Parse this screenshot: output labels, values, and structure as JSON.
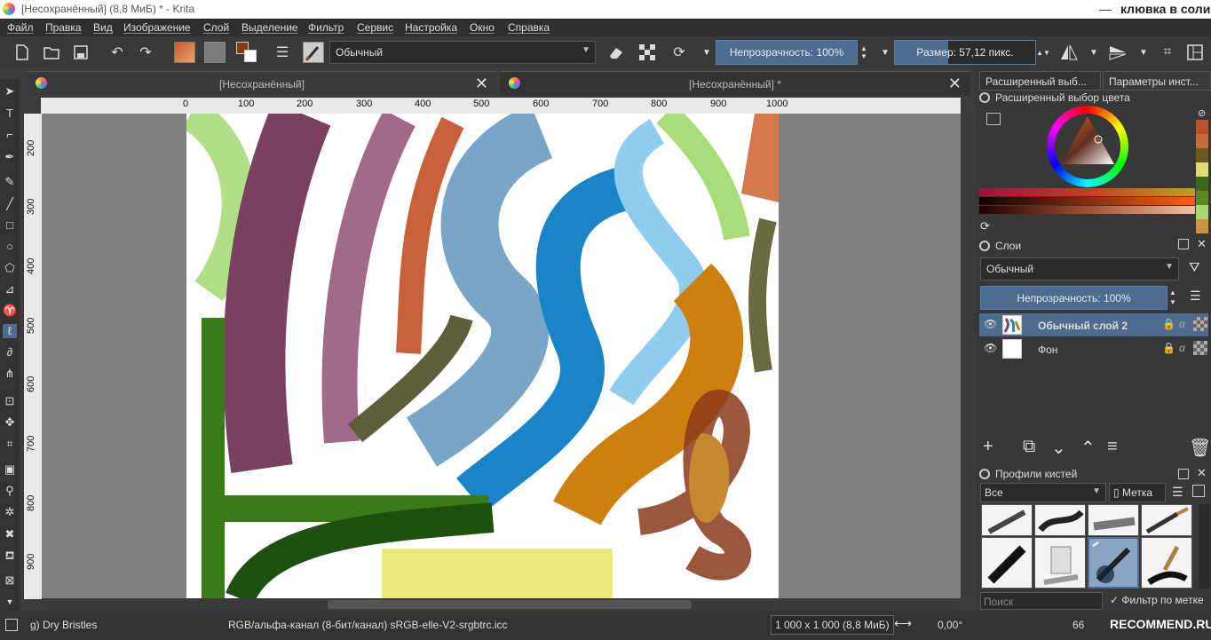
{
  "window": {
    "title": "[Несохранённый]  (8,8 МиБ)  * - Krita",
    "minimize_icon": "minimize-icon",
    "watermark": "клювка в соли"
  },
  "menu": [
    "Файл",
    "Правка",
    "Вид",
    "Изображение",
    "Слой",
    "Выделение",
    "Фильтр",
    "Сервис",
    "Настройка",
    "Окно",
    "Справка"
  ],
  "toolbar": {
    "blend_mode": "Обычный",
    "opacity_label": "Непрозрачность: 100%",
    "size_label": "Размер: 57,12 пикс."
  },
  "tabs": [
    {
      "label": "[Несохранённый]"
    },
    {
      "label": "[Несохранённый]  *"
    }
  ],
  "ruler": {
    "h": [
      "0",
      "100",
      "200",
      "300",
      "400",
      "500",
      "600",
      "700",
      "800",
      "900",
      "1000"
    ],
    "v": [
      "200",
      "300",
      "400",
      "500",
      "600",
      "700",
      "800",
      "900"
    ]
  },
  "right_panel": {
    "tab1": "Расширенный выб...",
    "tab2": "Параметры инст...",
    "color_title": "Расширенный выбор цвета",
    "layers_title": "Слои",
    "layers_blend": "Обычный",
    "layers_opacity": "Непрозрачность:  100%",
    "layers": [
      {
        "name": "Обычный слой 2",
        "selected": true
      },
      {
        "name": "Фон",
        "selected": false
      }
    ],
    "brushes_title": "Профили кистей",
    "brush_filter": "Все",
    "brush_tag": "Метка",
    "search_placeholder": "Поиск",
    "filter_by_tag": "Фильтр по метке"
  },
  "status": {
    "brush": "g) Dry Bristles",
    "color_space": "RGB/альфа-канал (8-бит/канал)  sRGB-elle-V2-srgbtrc.icc",
    "dimensions": "1 000 x 1 000 (8,8 МиБ)",
    "rotation": "0,00°",
    "zoom": "66"
  },
  "colors": {
    "accent": "#4d6d90",
    "swatches": [
      "#c0502a",
      "#c86a3a",
      "#d0843a",
      "#dede70",
      "#3a6a18",
      "#5a8a20",
      "#a8d870",
      "#8a5020"
    ]
  },
  "watermark2": "RECOMMEND.RU"
}
